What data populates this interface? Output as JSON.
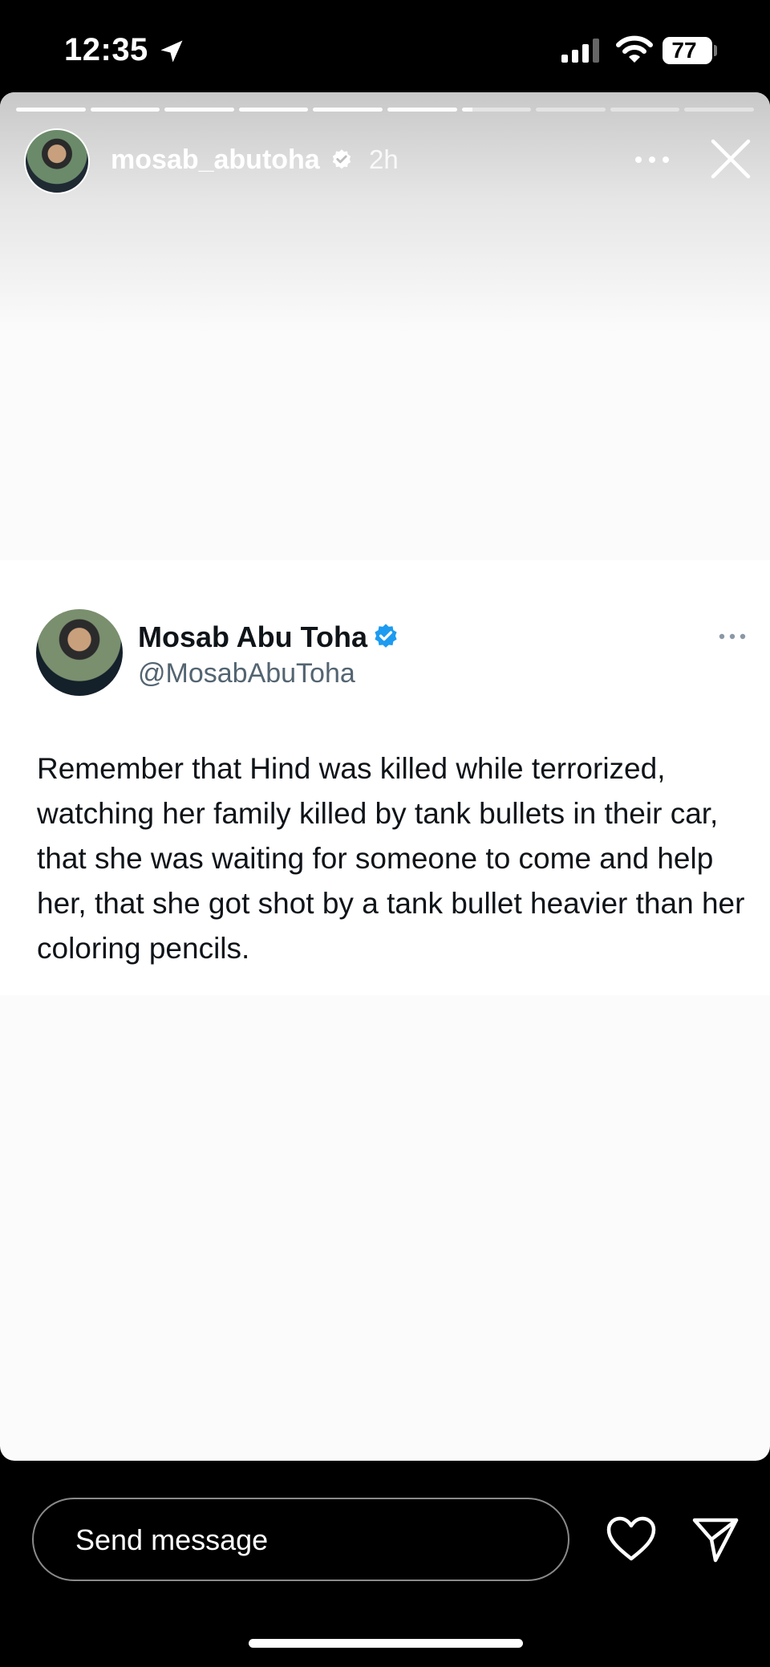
{
  "status_bar": {
    "time": "12:35",
    "battery": "77"
  },
  "story": {
    "username": "mosab_abutoha",
    "time_ago": "2h",
    "progress": {
      "segments_total": 10,
      "segments_viewed": 6,
      "current_segment_progress": 0.15
    }
  },
  "tweet": {
    "display_name": "Mosab Abu Toha",
    "handle": "@MosabAbuToha",
    "text": "Remember that Hind was killed while terrorized, watching her family killed by tank bullets in their car, that she was waiting for someone to come and help her, that she got shot by a tank bullet heavier than her coloring pencils."
  },
  "bottom_bar": {
    "message_placeholder": "Send message"
  },
  "colors": {
    "verified": "#1d9bf0",
    "background": "#000000",
    "story_bg": "#fbfbfb"
  }
}
